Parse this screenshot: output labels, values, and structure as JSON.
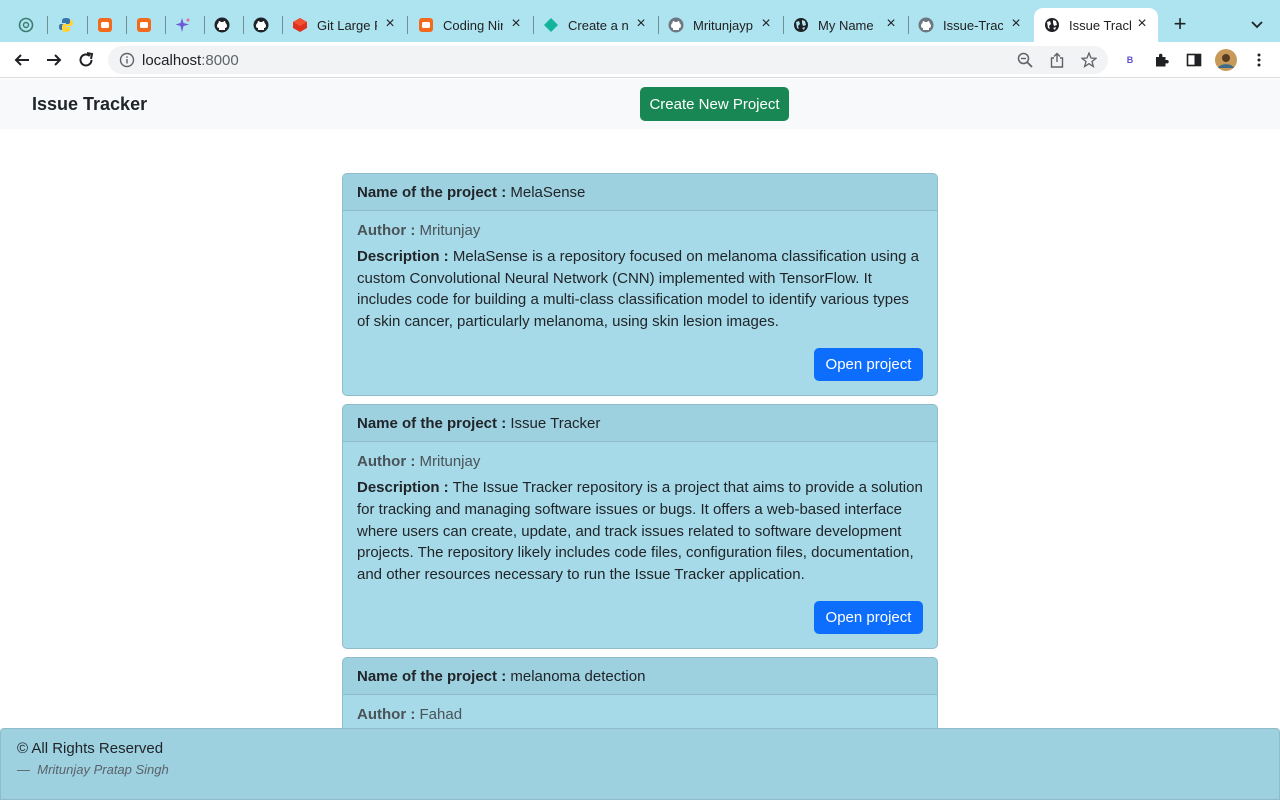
{
  "browser": {
    "tabs": [
      {
        "title": "",
        "icon": "openai-icon"
      },
      {
        "title": "",
        "icon": "python-icon"
      },
      {
        "title": "",
        "icon": "coding-ninjas-icon"
      },
      {
        "title": "",
        "icon": "coding-ninjas-icon"
      },
      {
        "title": "",
        "icon": "sparkle-icon"
      },
      {
        "title": "",
        "icon": "github-icon"
      },
      {
        "title": "",
        "icon": "github-icon"
      },
      {
        "title": "Git Large F",
        "icon": "git-lfs-icon"
      },
      {
        "title": "Coding Nin",
        "icon": "coding-ninjas-icon"
      },
      {
        "title": "Create a ne",
        "icon": "diamond-icon"
      },
      {
        "title": "Mritunjayp",
        "icon": "github-icon"
      },
      {
        "title": "My Name",
        "icon": "globe-icon"
      },
      {
        "title": "Issue-Trac",
        "icon": "github-icon"
      },
      {
        "title": "Issue Track",
        "icon": "globe-icon",
        "active": true
      }
    ],
    "url_host": "localhost",
    "url_port": ":8000",
    "extension_label": "B"
  },
  "navbar": {
    "brand": "Issue Tracker",
    "create_button": "Create New Project"
  },
  "labels": {
    "project_name": "Name of the project :",
    "author": "Author :",
    "description": "Description :",
    "open_button": "Open project"
  },
  "projects": [
    {
      "name": "MelaSense",
      "author": "Mritunjay",
      "description": "MelaSense is a repository focused on melanoma classification using a custom Convolutional Neural Network (CNN) implemented with TensorFlow. It includes code for building a multi-class classification model to identify various types of skin cancer, particularly melanoma, using skin lesion images."
    },
    {
      "name": "Issue Tracker",
      "author": "Mritunjay",
      "description": "The Issue Tracker repository is a project that aims to provide a solution for tracking and managing software issues or bugs. It offers a web-based interface where users can create, update, and track issues related to software development projects. The repository likely includes code files, configuration files, documentation, and other resources necessary to run the Issue Tracker application."
    },
    {
      "name": "melanoma detection",
      "author": "Fahad",
      "description": ""
    }
  ],
  "footer": {
    "rights": "© All Rights Reserved",
    "signature_dash": "—",
    "signature": "Mritunjay Pratap Singh"
  },
  "colors": {
    "tabstrip": "#aee3f0",
    "card": "#a6dae8",
    "card_header": "#9dd1e0",
    "create_button": "#198754",
    "open_button": "#0d6efd"
  }
}
